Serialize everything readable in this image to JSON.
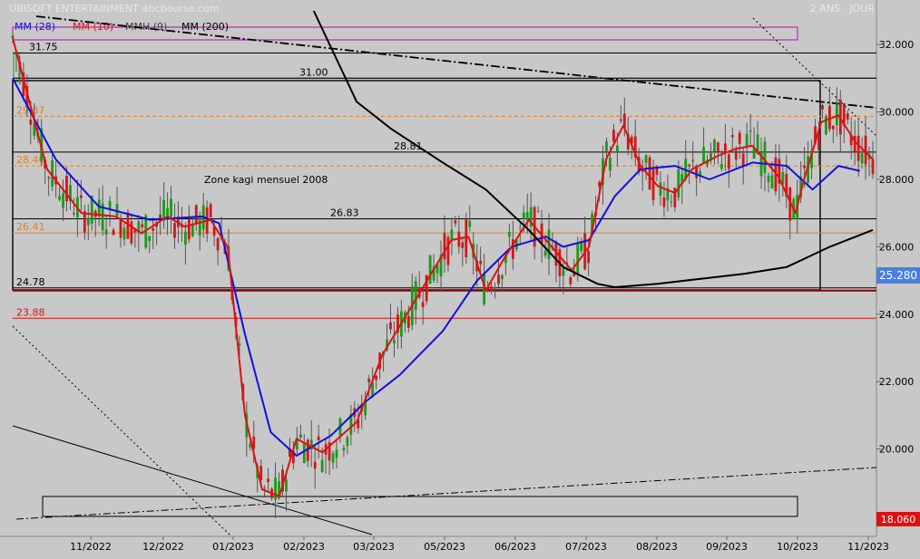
{
  "header": {
    "title": "UBISOFT ENTERTAINMENT",
    "source": "abcbourse.com",
    "period": "2 ANS · JOUR"
  },
  "legend": [
    {
      "label": "MM (28)",
      "color": "#1010e0"
    },
    {
      "label": "MM (10)",
      "color": "#e01010"
    },
    {
      "label": "MMH (9)",
      "color": "#404040"
    },
    {
      "label": "MM (200)",
      "color": "#000000"
    }
  ],
  "annotations": {
    "zone_label": "Zone kagi mensuel 2008"
  },
  "chart_data": {
    "type": "line",
    "title": "UBISOFT ENTERTAINMENT",
    "ylim": [
      17.5,
      33.2
    ],
    "y_ticks": [
      18.0,
      20.0,
      22.0,
      24.0,
      26.0,
      28.0,
      30.0,
      32.0
    ],
    "y_tick_labels": [
      "18.000",
      "20.000",
      "22.000",
      "24.000",
      "26.000",
      "28.000",
      "30.000",
      "32.000"
    ],
    "x_tick_labels": [
      "11/2022",
      "12/2022",
      "01/2023",
      "02/2023",
      "03/2023",
      "05/2023",
      "06/2023",
      "07/2023",
      "08/2023",
      "09/2023",
      "10/2023",
      "11/2023"
    ],
    "last_price": 25.28,
    "last_price_label": "25.280",
    "low_marker": 18.06,
    "low_marker_label": "18.060",
    "levels": [
      {
        "value": 31.75,
        "label": "31.75",
        "color": "#000000",
        "style": "solid"
      },
      {
        "value": 31.0,
        "label": "31.00",
        "color": "#000000",
        "style": "solid"
      },
      {
        "value": 29.87,
        "label": "29.87",
        "color": "#e08020",
        "style": "dashed"
      },
      {
        "value": 28.81,
        "label": "28.81",
        "color": "#000000",
        "style": "solid"
      },
      {
        "value": 28.4,
        "label": "28.40",
        "color": "#e08020",
        "style": "dashed"
      },
      {
        "value": 26.83,
        "label": "26.83",
        "color": "#000000",
        "style": "solid"
      },
      {
        "value": 26.41,
        "label": "26.41",
        "color": "#e08020",
        "style": "solid"
      },
      {
        "value": 24.78,
        "label": "24.78",
        "color": "#000000",
        "style": "solid"
      },
      {
        "value": 24.7,
        "label": "24.70",
        "color": "#8b0000",
        "style": "solid"
      },
      {
        "value": 23.88,
        "label": "23.88",
        "color": "#e01010",
        "style": "solid"
      }
    ],
    "moving_averages": [
      {
        "name": "MM (28)",
        "color": "#1010e0",
        "values": [
          [
            0,
            31.0
          ],
          [
            0.05,
            28.6
          ],
          [
            0.1,
            27.2
          ],
          [
            0.16,
            26.8
          ],
          [
            0.22,
            26.9
          ],
          [
            0.24,
            26.7
          ],
          [
            0.27,
            23.4
          ],
          [
            0.3,
            20.5
          ],
          [
            0.33,
            19.8
          ],
          [
            0.37,
            20.4
          ],
          [
            0.41,
            21.4
          ],
          [
            0.45,
            22.2
          ],
          [
            0.5,
            23.5
          ],
          [
            0.54,
            25.0
          ],
          [
            0.58,
            26.0
          ],
          [
            0.62,
            26.3
          ],
          [
            0.64,
            26.0
          ],
          [
            0.67,
            26.2
          ],
          [
            0.7,
            27.5
          ],
          [
            0.73,
            28.3
          ],
          [
            0.77,
            28.4
          ],
          [
            0.81,
            28.0
          ],
          [
            0.86,
            28.5
          ],
          [
            0.9,
            28.4
          ],
          [
            0.93,
            27.7
          ],
          [
            0.96,
            28.4
          ],
          [
            0.985,
            28.25
          ]
        ]
      },
      {
        "name": "MM (10)",
        "color": "#e01010",
        "values": [
          [
            0,
            32.2
          ],
          [
            0.04,
            28.3
          ],
          [
            0.08,
            27.0
          ],
          [
            0.12,
            26.9
          ],
          [
            0.15,
            26.4
          ],
          [
            0.18,
            26.9
          ],
          [
            0.2,
            26.6
          ],
          [
            0.23,
            26.8
          ],
          [
            0.25,
            26.0
          ],
          [
            0.27,
            21.0
          ],
          [
            0.29,
            18.8
          ],
          [
            0.31,
            18.6
          ],
          [
            0.33,
            20.3
          ],
          [
            0.36,
            19.9
          ],
          [
            0.4,
            20.8
          ],
          [
            0.43,
            22.8
          ],
          [
            0.47,
            24.5
          ],
          [
            0.51,
            26.2
          ],
          [
            0.53,
            26.3
          ],
          [
            0.55,
            24.7
          ],
          [
            0.57,
            25.6
          ],
          [
            0.6,
            26.8
          ],
          [
            0.63,
            25.9
          ],
          [
            0.65,
            25.3
          ],
          [
            0.67,
            26.0
          ],
          [
            0.69,
            28.6
          ],
          [
            0.71,
            29.6
          ],
          [
            0.73,
            28.4
          ],
          [
            0.75,
            27.8
          ],
          [
            0.77,
            27.6
          ],
          [
            0.79,
            28.3
          ],
          [
            0.82,
            28.7
          ],
          [
            0.84,
            28.9
          ],
          [
            0.86,
            29.0
          ],
          [
            0.89,
            28.1
          ],
          [
            0.91,
            27.0
          ],
          [
            0.92,
            28.0
          ],
          [
            0.94,
            29.7
          ],
          [
            0.96,
            29.9
          ],
          [
            0.98,
            29.1
          ],
          [
            1.0,
            28.6
          ]
        ]
      },
      {
        "name": "MM (200)",
        "color": "#000000",
        "values": [
          [
            0.35,
            33.0
          ],
          [
            0.4,
            30.3
          ],
          [
            0.44,
            29.5
          ],
          [
            0.5,
            28.5
          ],
          [
            0.55,
            27.7
          ],
          [
            0.6,
            26.5
          ],
          [
            0.64,
            25.4
          ],
          [
            0.68,
            24.9
          ],
          [
            0.7,
            24.8
          ],
          [
            0.75,
            24.9
          ],
          [
            0.8,
            25.05
          ],
          [
            0.85,
            25.2
          ],
          [
            0.9,
            25.4
          ],
          [
            0.95,
            26.0
          ],
          [
            1.0,
            26.5
          ]
        ]
      }
    ]
  }
}
